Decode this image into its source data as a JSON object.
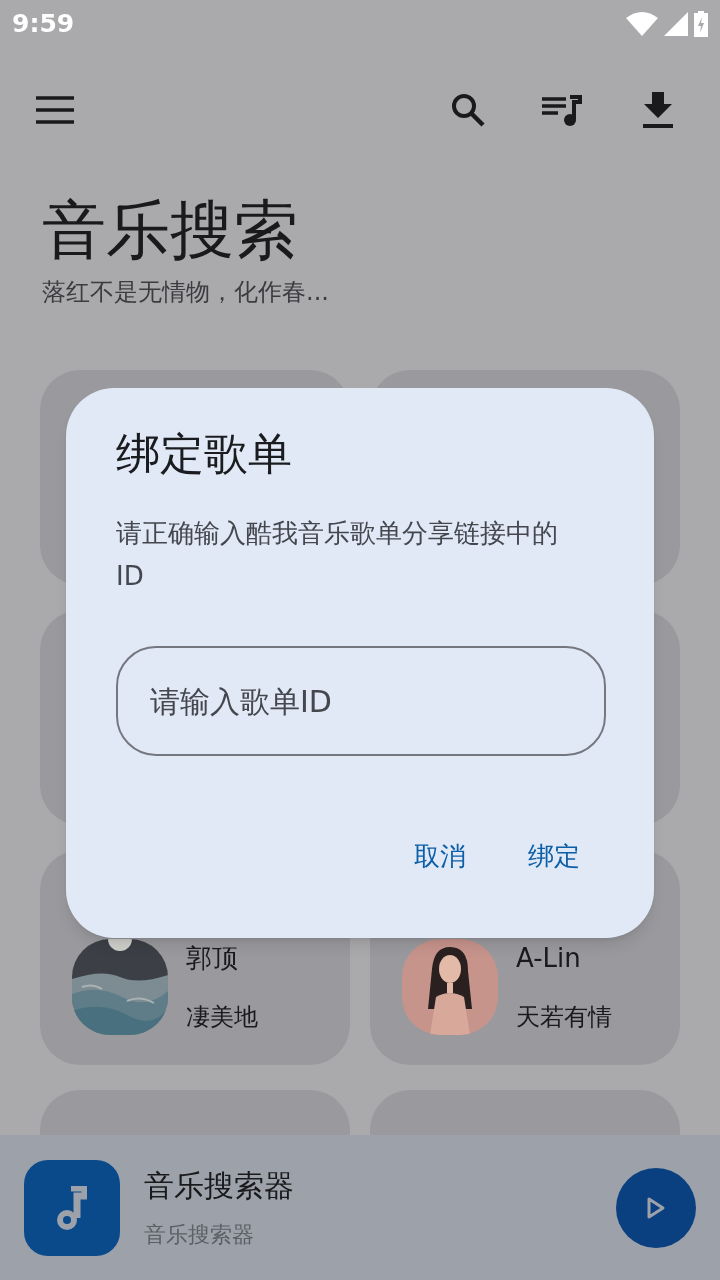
{
  "status_bar": {
    "time": "9:59"
  },
  "header": {
    "title": "音乐搜索",
    "subtitle": "落红不是无情物，化作春..."
  },
  "song_cards": [
    {
      "artist": "郭顶",
      "song": "凄美地"
    },
    {
      "artist": "A-Lin",
      "song": "天若有情"
    }
  ],
  "dialog": {
    "title": "绑定歌单",
    "message": "请正确输入酷我音乐歌单分享链接中的ID",
    "input": {
      "placeholder": "请输入歌单ID"
    },
    "buttons": [
      "取消",
      "绑定"
    ]
  },
  "player": {
    "title": "音乐搜索器",
    "subtitle": "音乐搜索器",
    "playing": false
  }
}
